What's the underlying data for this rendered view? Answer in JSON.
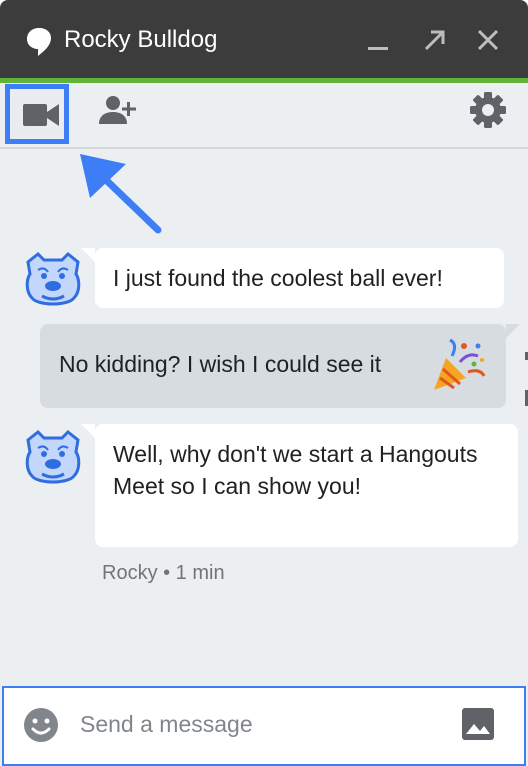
{
  "window": {
    "title": "Rocky Bulldog",
    "title_icon": "hangouts-bubble-icon",
    "controls": [
      "minimize-icon",
      "popout-icon",
      "close-icon"
    ]
  },
  "toolbar": {
    "video_icon": "video-camera-icon",
    "add_people_icon": "add-person-icon",
    "settings_icon": "gear-icon"
  },
  "messages": [
    {
      "sender": "Rocky",
      "direction": "incoming",
      "text": "I just found the coolest ball ever!"
    },
    {
      "sender": "me",
      "direction": "outgoing",
      "text": "No kidding? I wish I could see it",
      "emoji": "party-popper"
    },
    {
      "sender": "Rocky",
      "direction": "incoming",
      "text": "Well, why don't we start a Hangouts Meet so I can show you!"
    }
  ],
  "meta": {
    "text": "Rocky • 1 min"
  },
  "composer": {
    "placeholder": "Send a message",
    "emoji_icon": "smiley-icon",
    "image_icon": "image-icon"
  },
  "colors": {
    "titlebar": "#3c3c3c",
    "accent_green": "#62b33a",
    "highlight_blue": "#3d7df5",
    "chat_background": "#eceff1",
    "outgoing_bubble": "#d7dce0"
  }
}
